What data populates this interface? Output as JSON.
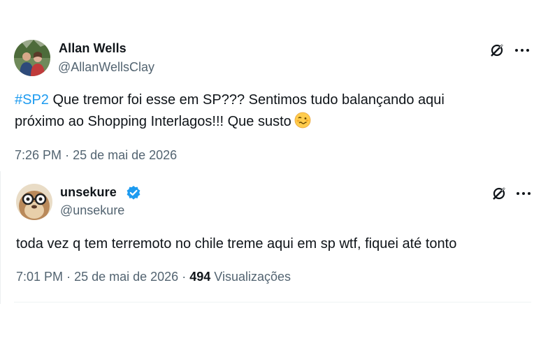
{
  "tweets": [
    {
      "name": "Allan Wells",
      "handle": "@AllanWellsClay",
      "verified": false,
      "hashtag": "#SP2",
      "text_line1": " Que tremor foi esse em SP??? Sentimos tudo balançando aqui",
      "text_line2": "próximo ao Shopping Interlagos!!! Que susto",
      "emoji": "woozy-face",
      "time": "7:26 PM",
      "separator": "·",
      "date": "25 de mai de 2026"
    },
    {
      "name": "unsekure",
      "handle": "@unsekure",
      "verified": true,
      "text": "toda vez q tem terremoto no chile treme aqui em sp wtf, fiquei até tonto",
      "time": "7:01 PM",
      "separator": "·",
      "date": "25 de mai de 2026",
      "views_count": "494",
      "views_label": "Visualizações"
    }
  ],
  "icons": {
    "grok": "grok-icon",
    "more": "more-options-icon",
    "verified": "verified-badge-icon"
  },
  "colors": {
    "accent": "#1d9bf0",
    "text": "#0f1419",
    "secondary": "#536471",
    "emoji": "#ffcc4d"
  }
}
